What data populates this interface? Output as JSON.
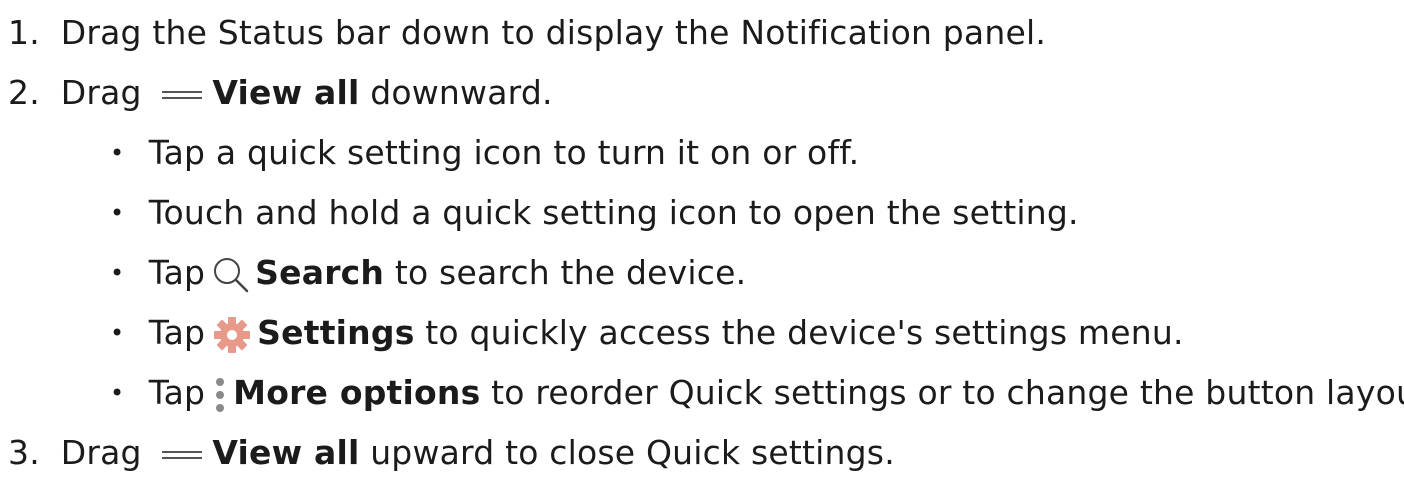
{
  "steps": [
    {
      "number": "1.",
      "text": "Drag the Status bar down to display the Notification panel."
    },
    {
      "number": "2.",
      "pre": "Drag",
      "bold": "View all",
      "post": "downward."
    },
    {
      "number": "3.",
      "pre": "Drag",
      "bold": "View all",
      "post": "upward to close Quick settings."
    }
  ],
  "bullets": [
    {
      "text": "Tap a quick setting icon to turn it on or off."
    },
    {
      "text": "Touch and hold a quick setting icon to open the setting."
    },
    {
      "pre": "Tap",
      "bold": "Search",
      "post": "to search the device.",
      "icon": "search-icon"
    },
    {
      "pre": "Tap",
      "bold": "Settings",
      "post": "to quickly access the device's settings menu.",
      "icon": "gear-icon"
    },
    {
      "pre": "Tap",
      "bold": "More options",
      "post": "to reorder Quick settings or to change the button layout.",
      "icon": "more-options-icon"
    }
  ],
  "icons": {
    "view_all": "drag-handle-icon",
    "bullet": "•"
  },
  "colors": {
    "text": "#1b1b1b",
    "gear": "#e79a8a",
    "more": "#8a8a8a"
  }
}
